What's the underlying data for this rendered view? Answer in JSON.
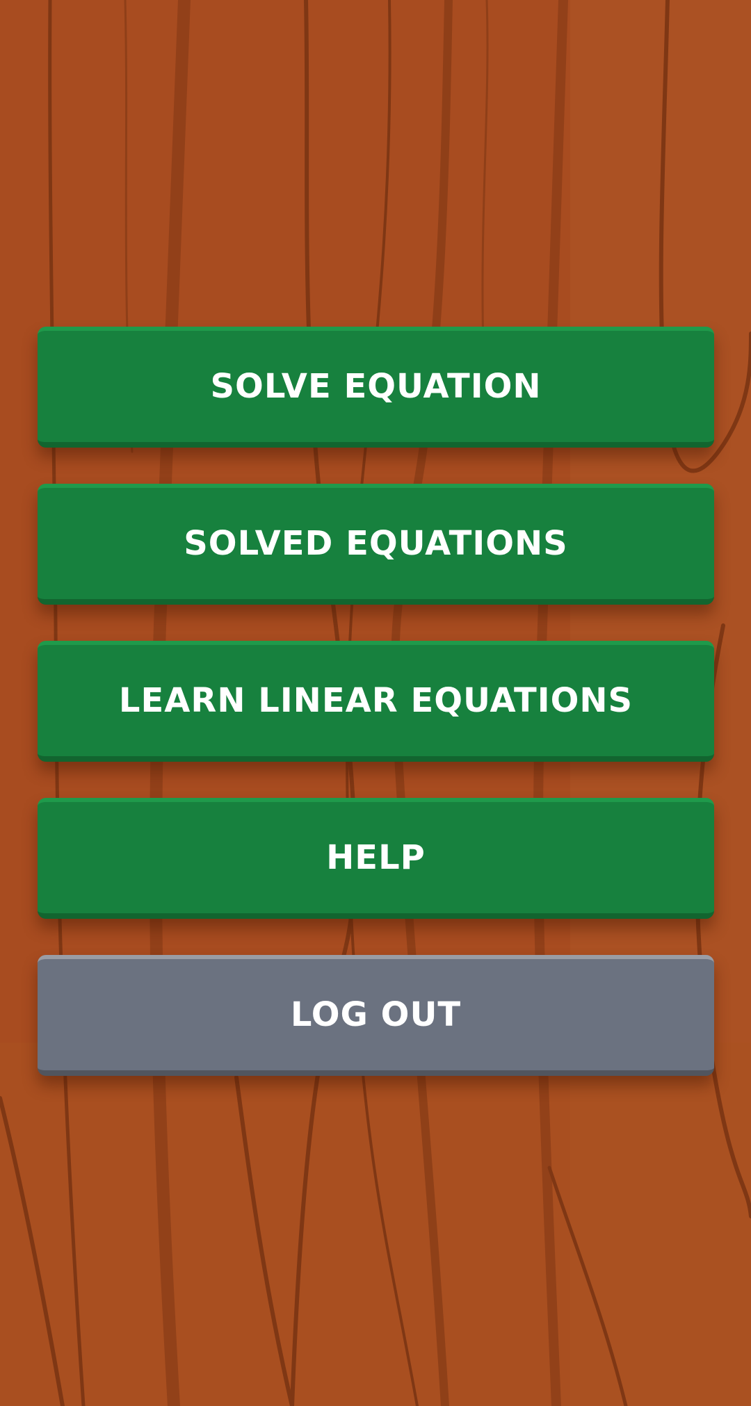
{
  "background": {
    "color": "#a84c20",
    "grain_color": "#7f3714"
  },
  "menu": {
    "solve_equation": "SOLVE EQUATION",
    "solved_equations": "SOLVED EQUATIONS",
    "learn_linear_equations": "LEARN LINEAR EQUATIONS",
    "help": "HELP",
    "log_out": "LOG OUT"
  },
  "colors": {
    "primary_button": "#17813e",
    "secondary_button": "#6b7280",
    "button_text": "#ffffff"
  }
}
